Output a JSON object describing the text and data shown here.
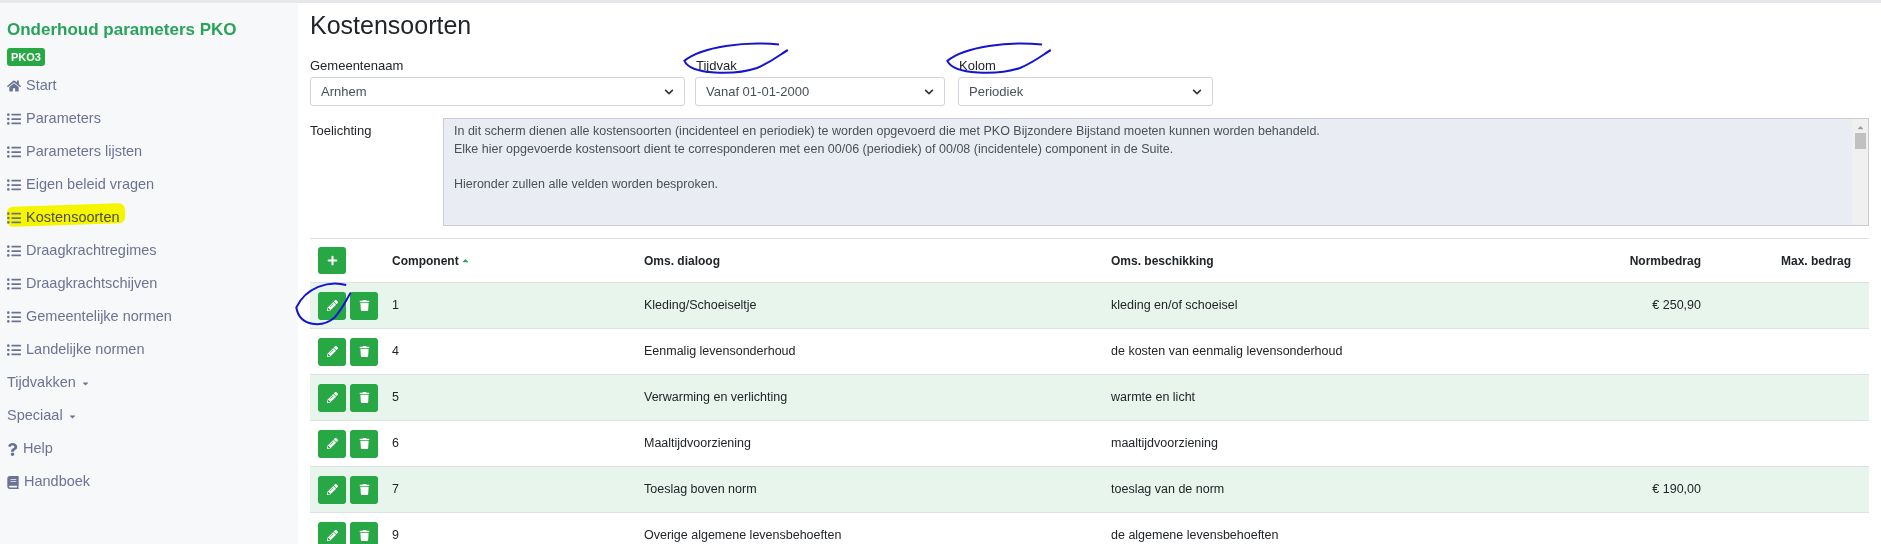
{
  "sidebar": {
    "title": "Onderhoud parameters PKO",
    "badge": "PKO3",
    "items": [
      {
        "label": "Start",
        "kind": "home",
        "highlighted": false
      },
      {
        "label": "Parameters",
        "kind": "list",
        "highlighted": false
      },
      {
        "label": "Parameters lijsten",
        "kind": "list",
        "highlighted": false
      },
      {
        "label": "Eigen beleid vragen",
        "kind": "list",
        "highlighted": false
      },
      {
        "label": "Kostensoorten",
        "kind": "list",
        "highlighted": true
      },
      {
        "label": "Draagkrachtregimes",
        "kind": "list",
        "highlighted": false
      },
      {
        "label": "Draagkrachtschijven",
        "kind": "list",
        "highlighted": false
      },
      {
        "label": "Gemeentelijke normen",
        "kind": "list",
        "highlighted": false
      },
      {
        "label": "Landelijke normen",
        "kind": "list",
        "highlighted": false
      },
      {
        "label": "Tijdvakken",
        "kind": "dropdown",
        "highlighted": false
      },
      {
        "label": "Speciaal",
        "kind": "dropdown",
        "highlighted": false
      },
      {
        "label": "Help",
        "kind": "help",
        "highlighted": false
      },
      {
        "label": "Handboek",
        "kind": "book",
        "highlighted": false
      }
    ]
  },
  "page": {
    "title": "Kostensoorten",
    "filters": [
      {
        "label": "Gemeentenaam",
        "value": "Arnhem",
        "circled": false
      },
      {
        "label": "Tijdvak",
        "value": "Vanaf 01-01-2000",
        "circled": true
      },
      {
        "label": "Kolom",
        "value": "Periodiek",
        "circled": true
      }
    ],
    "explanation": {
      "label": "Toelichting",
      "paragraphs": [
        [
          "In dit scherm dienen alle kostensoorten (incidenteel en periodiek) te worden opgevoerd die met PKO Bijzondere Bijstand moeten kunnen worden behandeld.",
          "Elke hier opgevoerde kostensoort dient te corresponderen met een 00/06 (periodiek) of 00/08 (incidentele) component in de Suite."
        ],
        [
          "Hieronder zullen alle velden worden besproken."
        ]
      ]
    }
  },
  "table": {
    "columns": [
      {
        "label": "Component",
        "sorted": true
      },
      {
        "label": "Oms. dialoog",
        "sorted": false
      },
      {
        "label": "Oms. beschikking",
        "sorted": false
      },
      {
        "label": "Normbedrag",
        "sorted": false
      },
      {
        "label": "Max. bedrag",
        "sorted": false
      }
    ],
    "rows": [
      {
        "component": "1",
        "dialoog": "Kleding/Schoeiseltje",
        "beschikking": "kleding en/of schoeisel",
        "normbedrag": "€ 250,90",
        "edit_circled": true
      },
      {
        "component": "4",
        "dialoog": "Eenmalig levensonderhoud",
        "beschikking": "de kosten van eenmalig levensonderhoud",
        "edit_circled": false
      },
      {
        "component": "5",
        "dialoog": "Verwarming en verlichting",
        "beschikking": "warmte en licht",
        "edit_circled": false
      },
      {
        "component": "6",
        "dialoog": "Maaltijdvoorziening",
        "beschikking": "maaltijdvoorziening",
        "edit_circled": false
      },
      {
        "component": "7",
        "dialoog": "Toeslag boven norm",
        "beschikking": "toeslag van de norm",
        "normbedrag": "€ 190,00",
        "edit_circled": false
      },
      {
        "component": "9",
        "dialoog": "Overige algemene levensbehoeften",
        "beschikking": "de algemene levensbehoeften",
        "edit_circled": false
      }
    ]
  }
}
